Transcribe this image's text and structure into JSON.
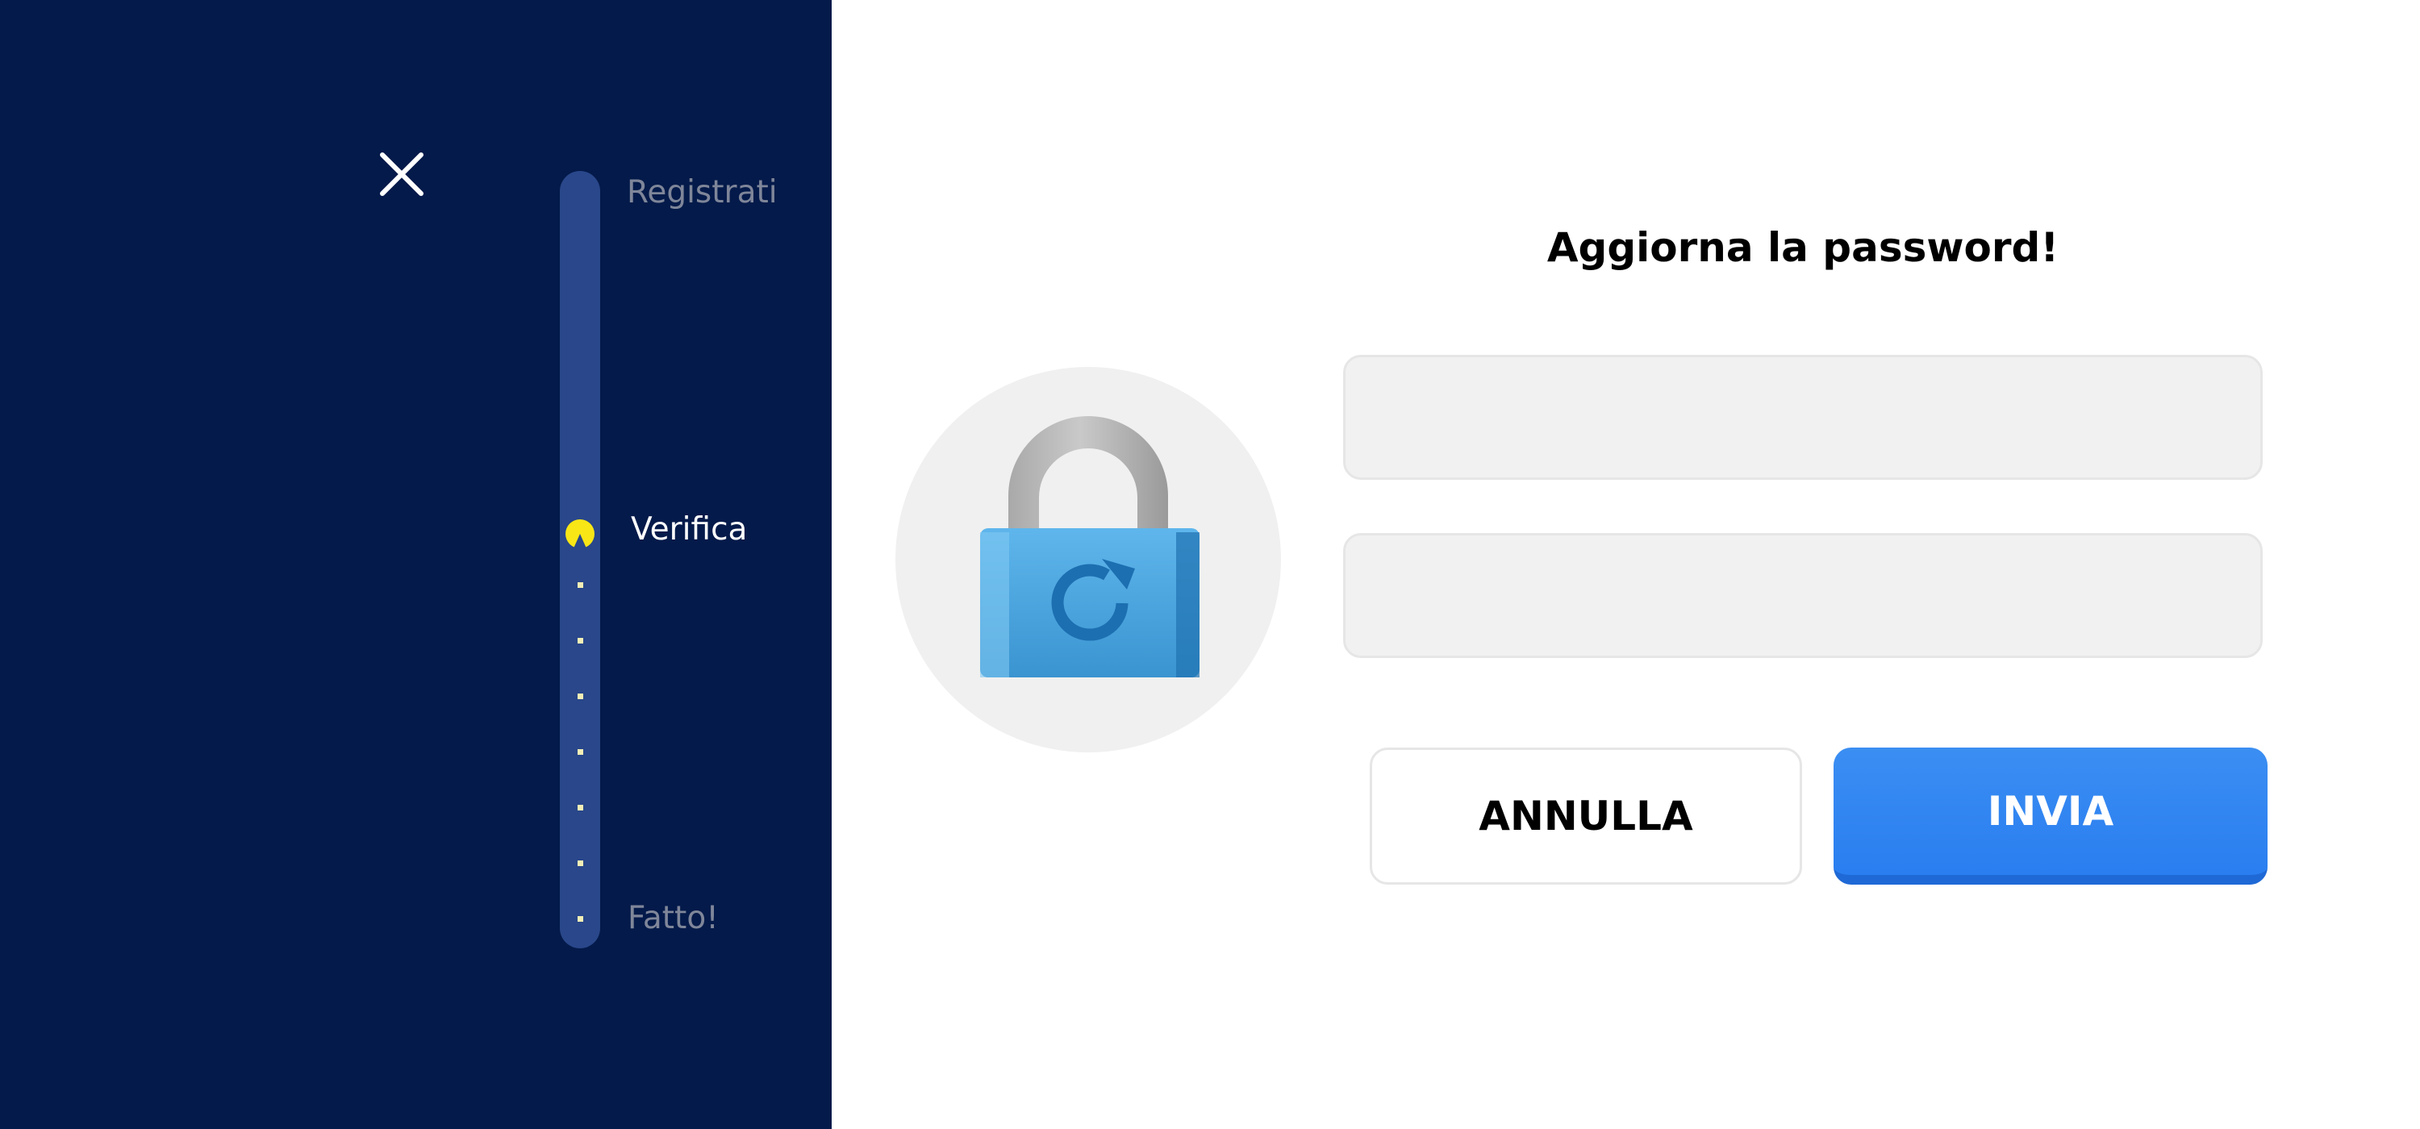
{
  "sidebar": {
    "background": "#041a4a",
    "close_icon": "close-icon",
    "progress": {
      "track_color": "#29478a",
      "marker_icon": "pacman-icon",
      "marker_color": "#f8e616",
      "dot_color": "#f4efb6",
      "steps": [
        {
          "label": "Registrati",
          "state": "inactive"
        },
        {
          "label": "Verifica",
          "state": "active"
        },
        {
          "label": "Fatto!",
          "state": "inactive"
        }
      ]
    }
  },
  "main": {
    "title": "Aggiorna la password!",
    "illustration_icon": "lock-refresh-icon",
    "fields": [
      {
        "value": "",
        "placeholder": ""
      },
      {
        "value": "",
        "placeholder": ""
      }
    ],
    "buttons": {
      "cancel_label": "ANNULLA",
      "submit_label": "INVIA",
      "submit_color": "#2a7ef0"
    }
  }
}
